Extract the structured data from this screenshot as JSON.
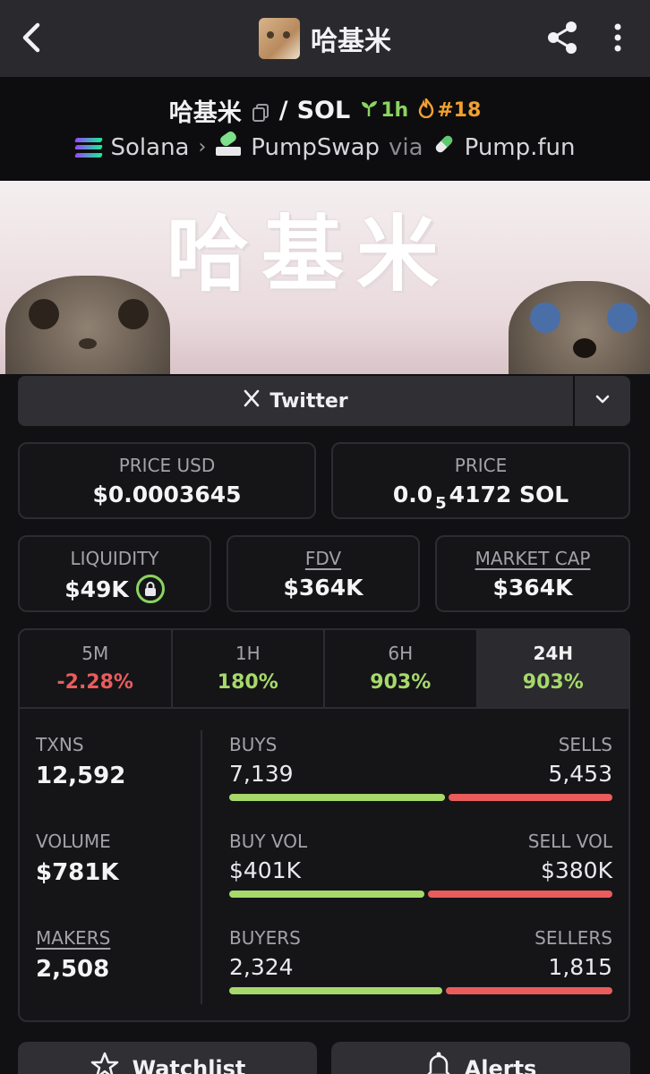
{
  "app": {
    "title": "哈基米"
  },
  "pair": {
    "base": "哈基米",
    "separator": "/",
    "quote": "SOL",
    "age": "1h",
    "rank": "#18",
    "chain": "Solana",
    "dex": "PumpSwap",
    "via": "via",
    "launchpad": "Pump.fun"
  },
  "banner": {
    "text": "哈基米"
  },
  "social": {
    "twitter_label": "Twitter"
  },
  "stats": {
    "price_usd_label": "PRICE USD",
    "price_usd": "$0.0003645",
    "price_label": "PRICE",
    "price_prefix": "0.0",
    "price_zeros": "5",
    "price_suffix": "4172 SOL",
    "liquidity_label": "LIQUIDITY",
    "liquidity": "$49K",
    "fdv_label": "FDV",
    "fdv": "$364K",
    "mcap_label": "MARKET CAP",
    "mcap": "$364K"
  },
  "timeframes": [
    {
      "label": "5M",
      "change": "-2.28%"
    },
    {
      "label": "1H",
      "change": "180%"
    },
    {
      "label": "6H",
      "change": "903%"
    },
    {
      "label": "24H",
      "change": "903%"
    }
  ],
  "activity": {
    "txns_label": "TXNS",
    "txns": "12,592",
    "volume_label": "VOLUME",
    "volume": "$781K",
    "makers_label": "MAKERS",
    "makers": "2,508",
    "buys_label": "BUYS",
    "buys": "7,139",
    "sells_label": "SELLS",
    "sells": "5,453",
    "buy_vol_label": "BUY VOL",
    "buy_vol": "$401K",
    "sell_vol_label": "SELL VOL",
    "sell_vol": "$380K",
    "buyers_label": "BUYERS",
    "buyers": "2,324",
    "sellers_label": "SELLERS",
    "sellers": "1,815",
    "buys_ratio": 0.567,
    "buy_vol_ratio": 0.513,
    "buyers_ratio": 0.561
  },
  "actions": {
    "watchlist": "Watchlist",
    "alerts": "Alerts"
  },
  "colors": {
    "positive": "#a6d96a",
    "negative": "#ea5c5c",
    "accent_green": "#8bd460",
    "accent_orange": "#f0a030"
  }
}
